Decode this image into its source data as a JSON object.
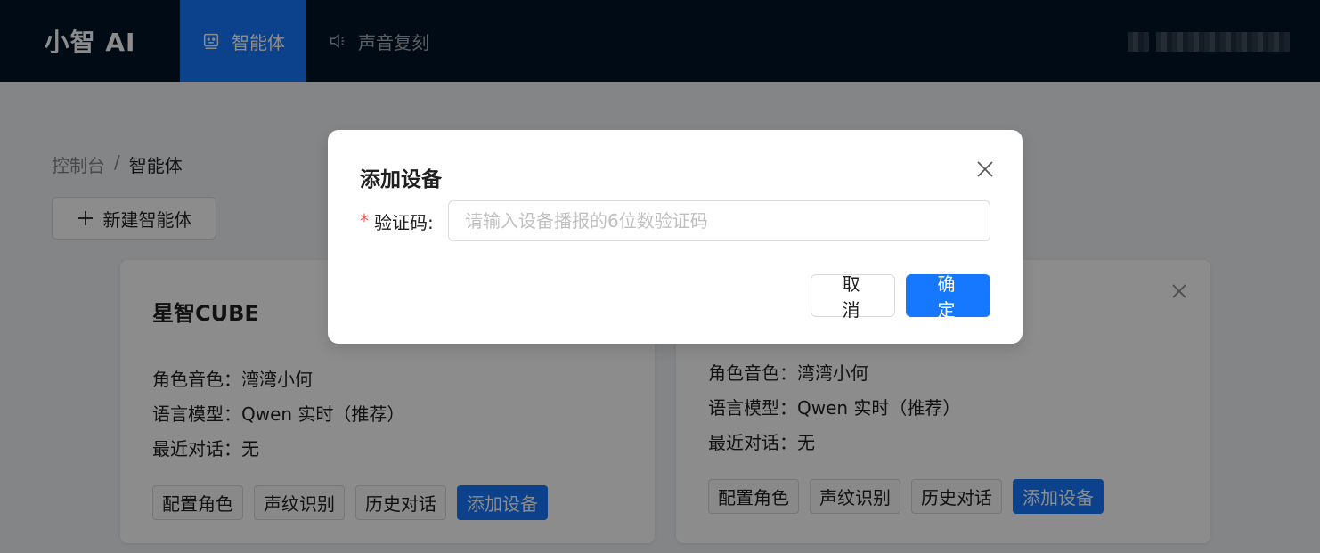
{
  "header": {
    "logo": "小智 AI",
    "nav": [
      {
        "label": "智能体",
        "icon": "robot-icon",
        "active": true
      },
      {
        "label": "声音复刻",
        "icon": "speaker-icon",
        "active": false
      }
    ]
  },
  "breadcrumb": {
    "root": "控制台",
    "separator": "/",
    "current": "智能体"
  },
  "toolbar": {
    "new_agent_label": "新建智能体"
  },
  "cards": [
    {
      "title": "星智CUBE",
      "voice": "角色音色：湾湾小何",
      "model": "语言模型：Qwen 实时（推荐）",
      "recent": "最近对话：无",
      "actions": [
        "配置角色",
        "声纹识别",
        "历史对话",
        "添加设备"
      ]
    },
    {
      "title": "",
      "voice": "角色音色：湾湾小何",
      "model": "语言模型：Qwen 实时（推荐）",
      "recent": "最近对话：无",
      "actions": [
        "配置角色",
        "声纹识别",
        "历史对话",
        "添加设备"
      ]
    }
  ],
  "modal": {
    "title": "添加设备",
    "field_label": "验证码:",
    "required_mark": "*",
    "input_value": "",
    "input_placeholder": "请输入设备播报的6位数验证码",
    "cancel_label": "取 消",
    "ok_label": "确 定"
  },
  "colors": {
    "header_bg": "#001529",
    "primary": "#1677ff",
    "mask": "rgba(0,0,0,0.45)"
  }
}
